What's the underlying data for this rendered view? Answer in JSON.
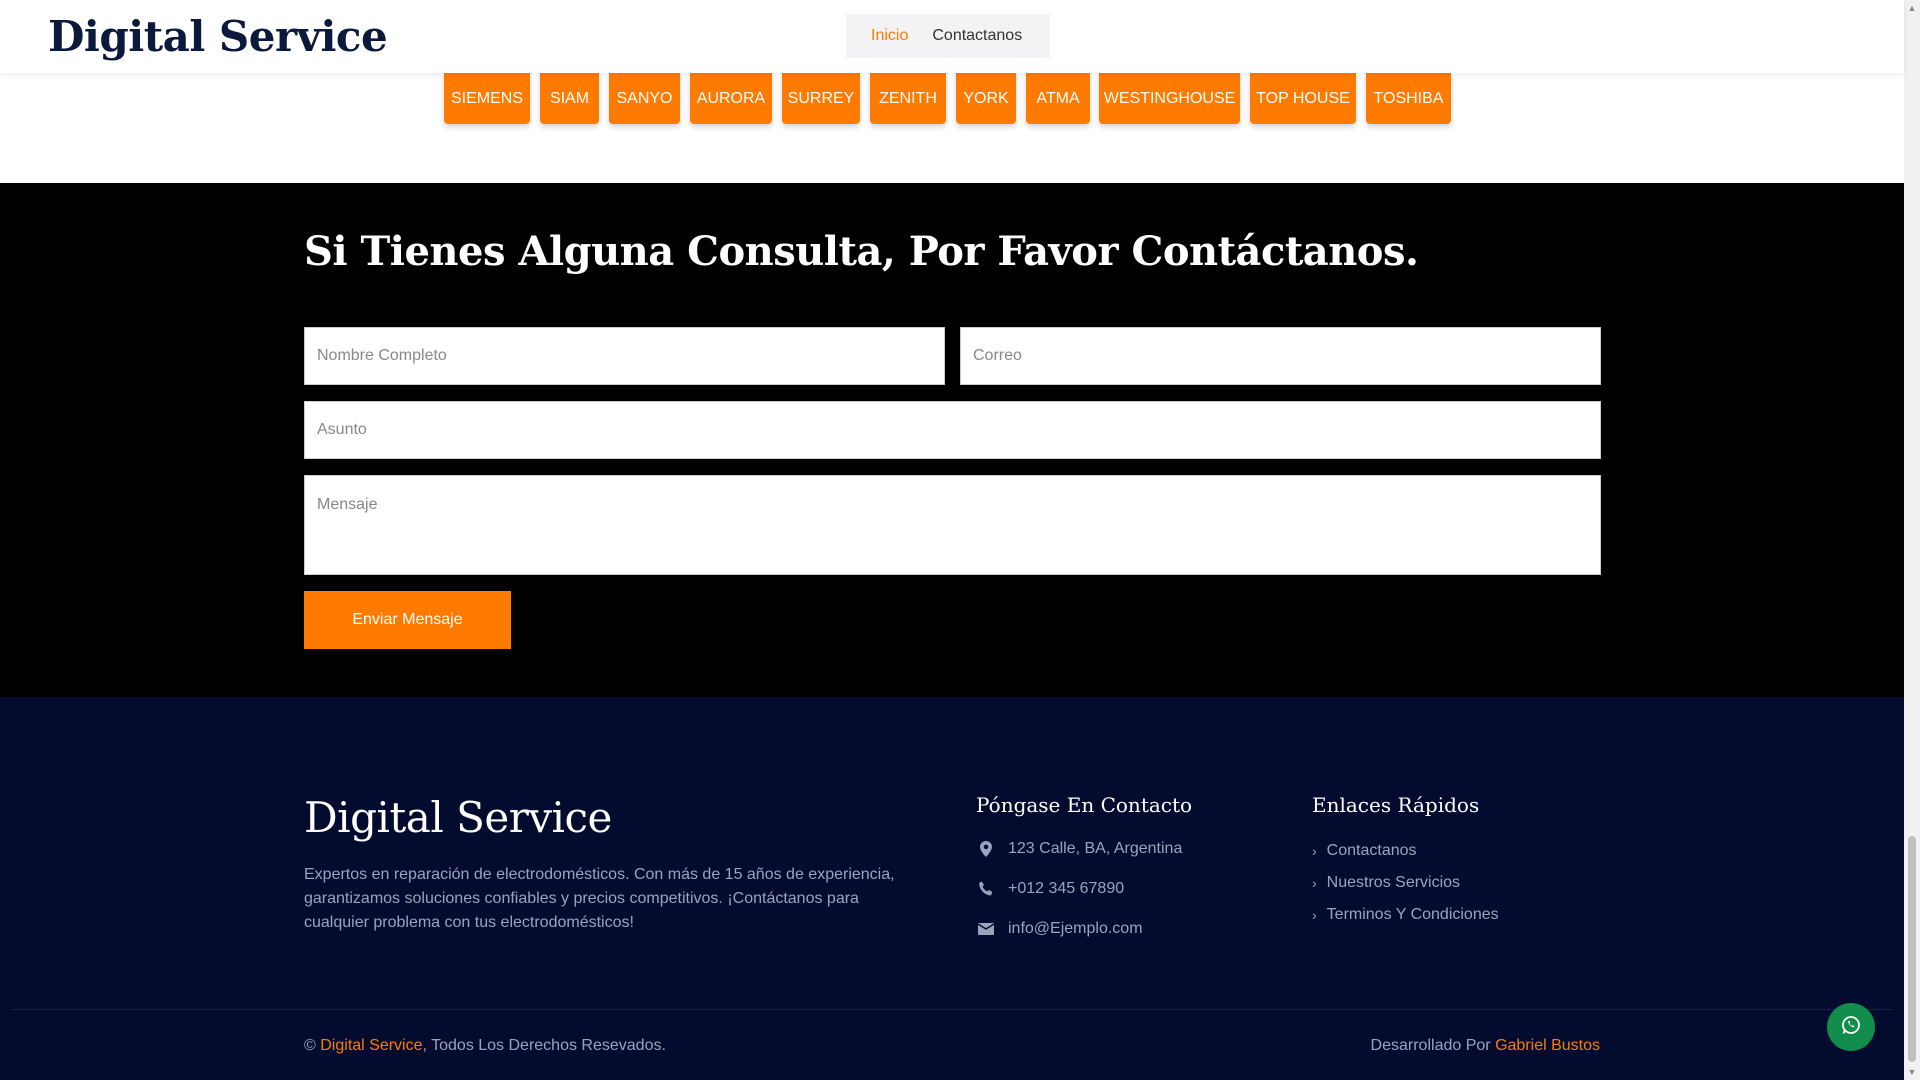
{
  "header": {
    "brand": "Digital Service",
    "nav": [
      {
        "label": "Inicio",
        "active": true
      },
      {
        "label": "Contactanos",
        "active": false
      }
    ]
  },
  "brands": [
    "SIEMENS",
    "SIAM",
    "SANYO",
    "AURORA",
    "SURREY",
    "ZENITH",
    "YORK",
    "ATMA",
    "WESTINGHOUSE",
    "TOP HOUSE",
    "TOSHIBA"
  ],
  "contact": {
    "title": "Si Tienes Alguna Consulta, Por Favor Contáctanos.",
    "name_placeholder": "Nombre Completo",
    "email_placeholder": "Correo",
    "subject_placeholder": "Asunto",
    "message_placeholder": "Mensaje",
    "submit_label": "Enviar Mensaje"
  },
  "footer": {
    "brand": "Digital Service",
    "description": "Expertos en reparación de electrodomésticos. Con más de 15 años de experiencia, garantizamos soluciones confiables y precios competitivos. ¡Contáctanos para cualquier problema con tus electrodomésticos!",
    "contact_heading": "Póngase En Contacto",
    "address": "123 Calle, BA, Argentina",
    "phone": "+012 345 67890",
    "email": "info@Ejemplo.com",
    "links_heading": "Enlaces Rápidos",
    "links": [
      "Contactanos",
      "Nuestros Servicios",
      "Terminos Y Condiciones"
    ],
    "copyright_prefix": "©",
    "copyright_brand": "Digital Service",
    "copyright_suffix": ", Todos Los Derechos Resevados.",
    "credit_prefix": "Desarrollado Por",
    "credit_name": "Gabriel Bustos"
  },
  "colors": {
    "accent": "#ff7a00",
    "footer_bg": "#030c2e",
    "whatsapp": "#128c4a"
  },
  "icons": [
    "map-marker-icon",
    "phone-icon",
    "envelope-icon",
    "chevron-right-icon",
    "whatsapp-icon"
  ]
}
